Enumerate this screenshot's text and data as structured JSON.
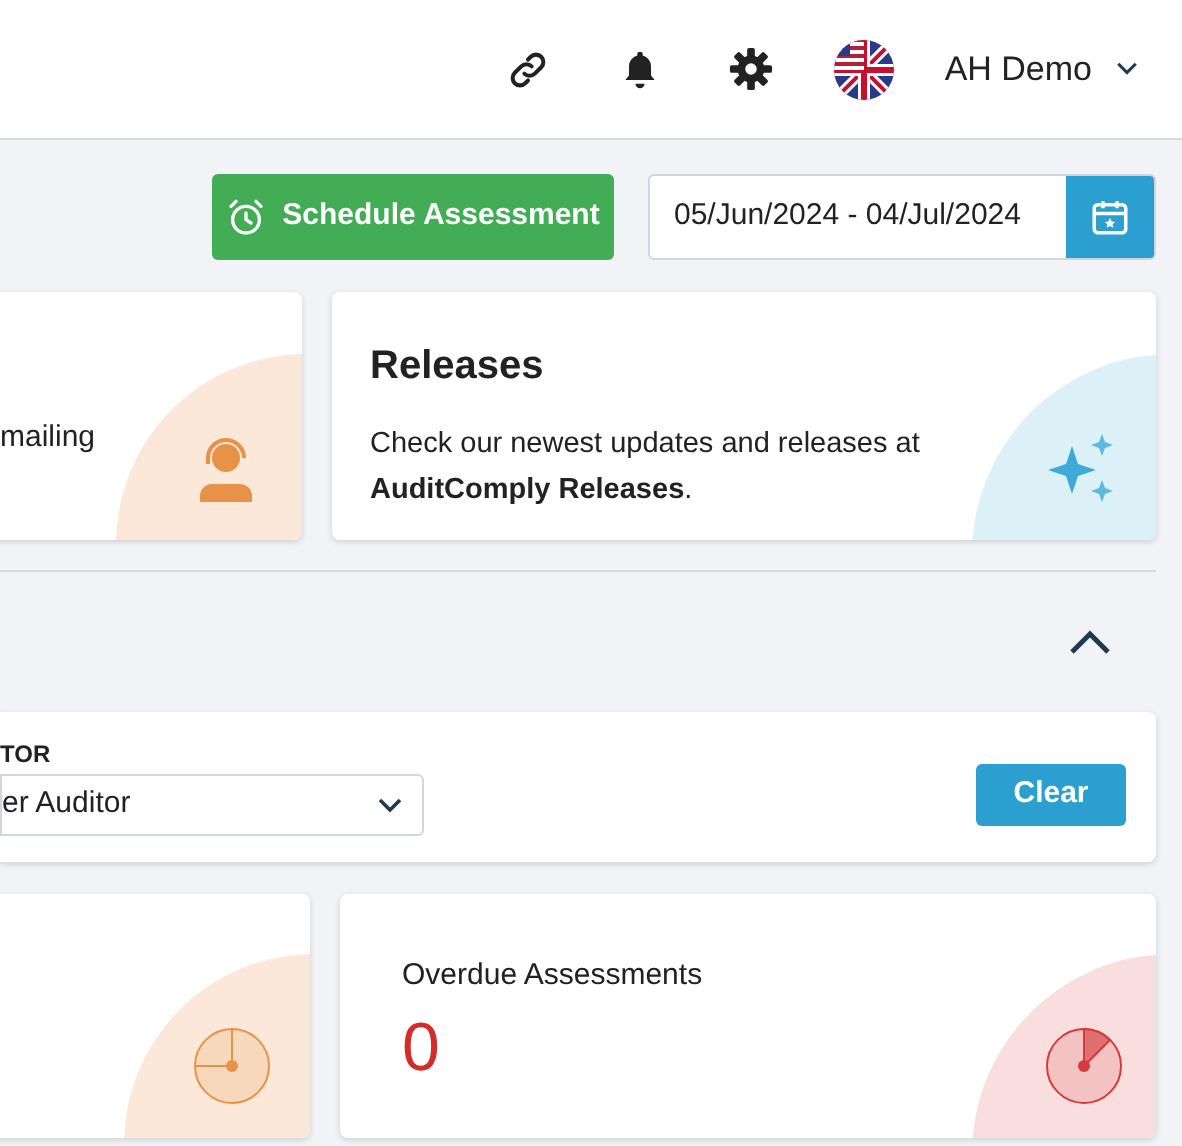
{
  "header": {
    "user_name": "AH Demo"
  },
  "toolbar": {
    "schedule_button": "Schedule Assessment",
    "date_range": "05/Jun/2024 - 04/Jul/2024"
  },
  "info_cards": [
    {
      "kind": "support",
      "text": "mailing"
    },
    {
      "kind": "releases",
      "title": "Releases",
      "text": "Check our newest updates and releases at **AuditComply Releases**."
    }
  ],
  "section": {
    "expanded": true
  },
  "filter": {
    "label": "TOR",
    "value": "er Auditor",
    "clear_button": "Clear"
  },
  "stat_cards": [
    {
      "kind": "pending"
    },
    {
      "kind": "overdue",
      "title": "Overdue Assessments",
      "value": "0"
    }
  ]
}
